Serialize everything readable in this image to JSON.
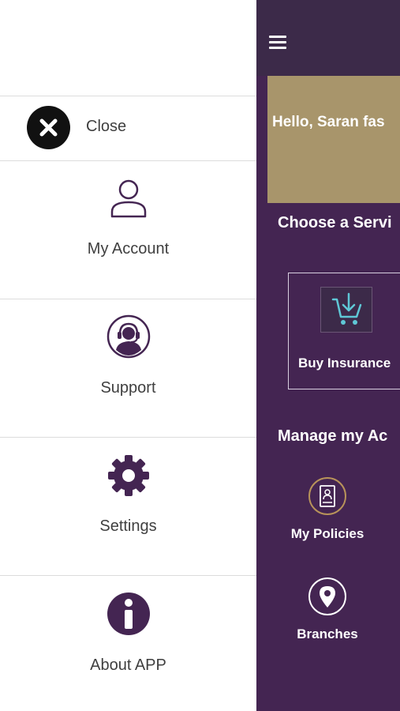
{
  "drawer": {
    "close_label": "Close",
    "items": [
      {
        "label": "My Account",
        "icon": "user-icon"
      },
      {
        "label": "Support",
        "icon": "headset-icon"
      },
      {
        "label": "Settings",
        "icon": "gear-icon"
      },
      {
        "label": "About APP",
        "icon": "info-icon"
      }
    ]
  },
  "main": {
    "greeting": "Hello, Saran  fas",
    "choose_service_title": "Choose a Servi",
    "services": [
      {
        "label": "Buy Insurance",
        "icon": "cart-download-icon"
      }
    ],
    "manage_title": "Manage my Ac",
    "manage_items": [
      {
        "label": "My Policies",
        "icon": "policy-document-icon"
      },
      {
        "label": "Branches",
        "icon": "location-pin-icon"
      }
    ]
  },
  "colors": {
    "brand_purple": "#442552",
    "topbar": "#3c2a49",
    "banner": "#a8956b",
    "accent_teal": "#5fc8d6",
    "accent_gold": "#b8935a"
  }
}
